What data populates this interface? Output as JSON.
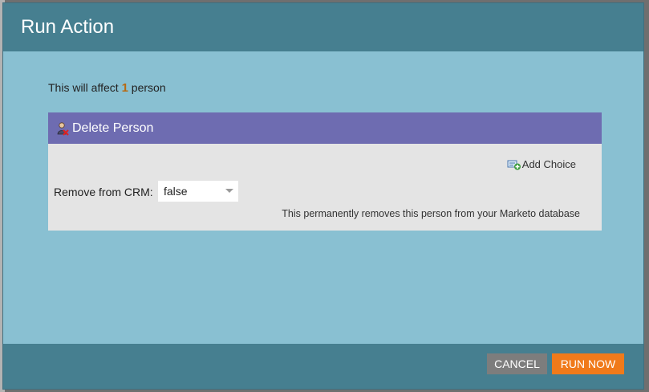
{
  "dialog": {
    "title": "Run Action",
    "affect": {
      "prefix": "This will affect",
      "count": "1",
      "suffix": "person"
    }
  },
  "panel": {
    "title": "Delete Person",
    "icon": "person-delete-icon",
    "add_choice_label": "Add Choice",
    "field": {
      "label": "Remove from CRM:",
      "value": "false"
    },
    "note": "This permanently removes this person from your Marketo database"
  },
  "footer": {
    "cancel_label": "CANCEL",
    "run_label": "RUN NOW"
  },
  "colors": {
    "header": "#467f90",
    "body": "#89c0d2",
    "panel_header": "#6e6cb1",
    "panel_body": "#e4e4e4",
    "count": "#b76a13",
    "run_button": "#f07a1a",
    "cancel_button": "#7d7d7d"
  }
}
